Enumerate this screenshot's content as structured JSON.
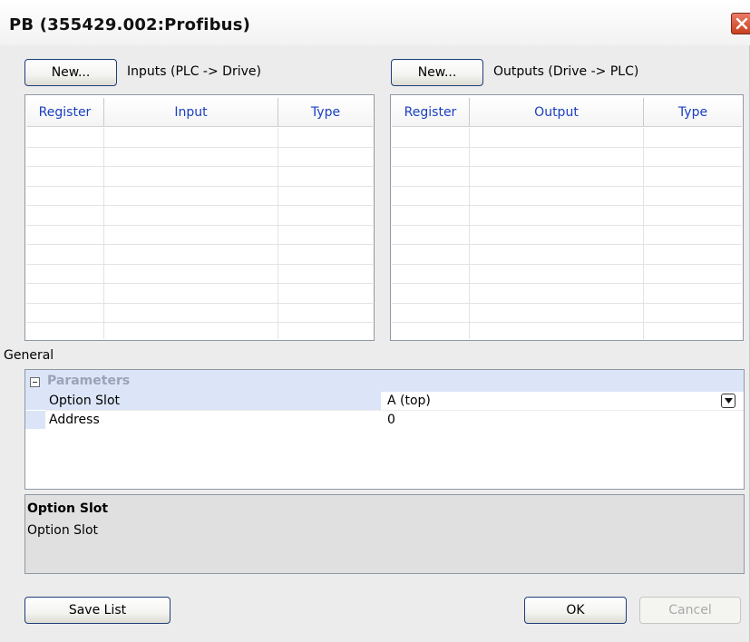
{
  "window": {
    "title": "PB (355429.002:Profibus)"
  },
  "inputs": {
    "new_button": "New...",
    "label": "Inputs (PLC -> Drive)",
    "columns": [
      "Register",
      "Input",
      "Type"
    ]
  },
  "outputs": {
    "new_button": "New...",
    "label": "Outputs (Drive -> PLC)",
    "columns": [
      "Register",
      "Output",
      "Type"
    ]
  },
  "general": {
    "label": "General",
    "category": "Parameters",
    "properties": [
      {
        "name": "Option Slot",
        "value": "A (top)"
      },
      {
        "name": "Address",
        "value": "0"
      }
    ]
  },
  "description": {
    "title": "Option Slot",
    "text": "Option Slot"
  },
  "footer": {
    "save_list": "Save List",
    "ok": "OK",
    "cancel": "Cancel"
  },
  "colors": {
    "header_text": "#1a3fc0",
    "category_bg": "#dbe5f7",
    "close_button": "#c8401f"
  }
}
